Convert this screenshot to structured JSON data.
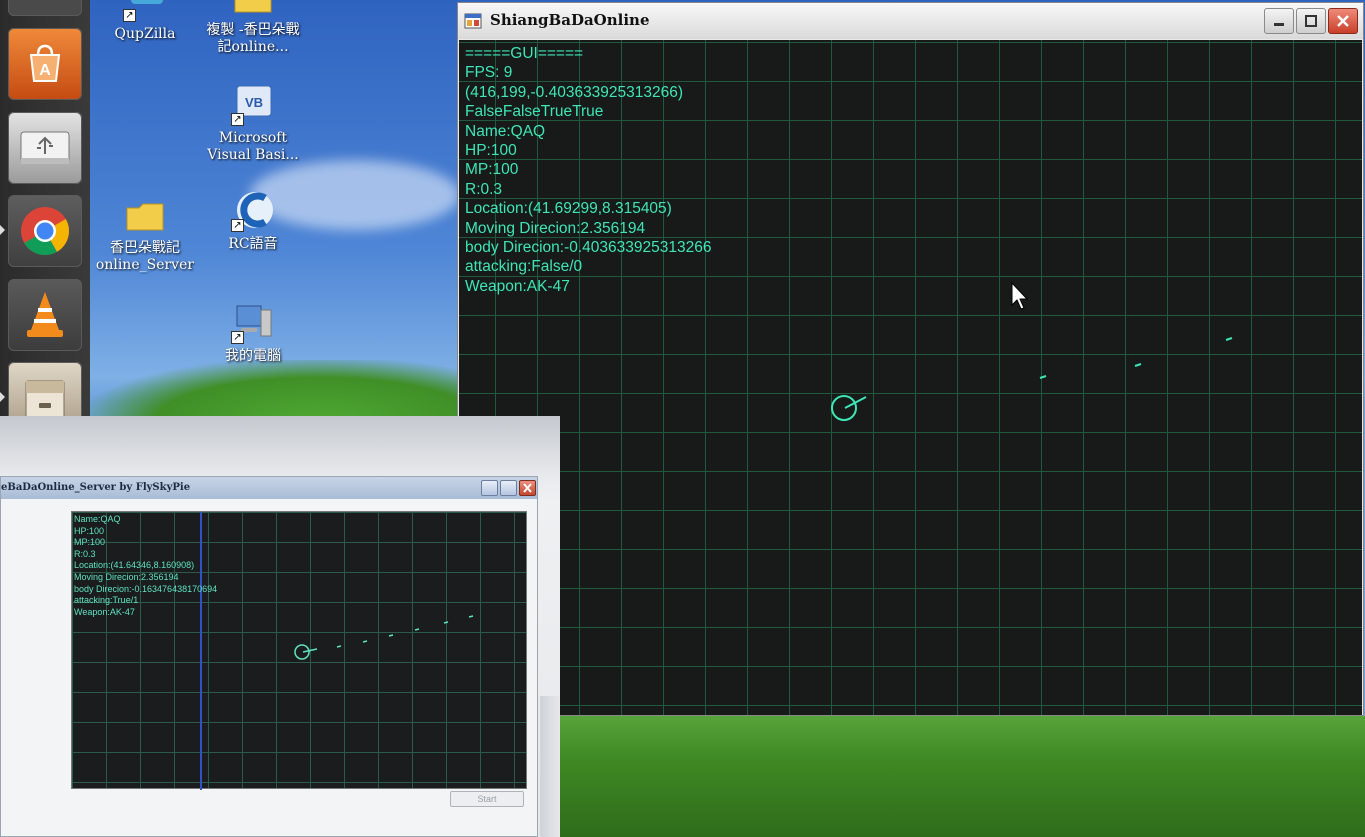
{
  "desktop": {
    "icons": [
      {
        "label": "QupZilla",
        "icon": "qupzilla-icon"
      },
      {
        "label": "複製 -香巴朵戰記online...",
        "icon": "folder-icon"
      },
      {
        "label": "Microsoft Visual Basi...",
        "icon": "visual-basic-icon"
      },
      {
        "label": "香巴朵戰記online_Server",
        "icon": "folder-icon"
      },
      {
        "label": "RC語音",
        "icon": "rc-voice-icon"
      },
      {
        "label": "我的電腦",
        "icon": "my-computer-icon"
      }
    ],
    "dock": [
      "software-center-icon",
      "usb-drive-icon",
      "chrome-icon",
      "vlc-icon",
      "files-icon"
    ]
  },
  "game_window": {
    "title": "ShiangBaDaOnline",
    "gui_lines": [
      "=====GUI=====",
      "FPS: 9",
      "(416,199,-0.403633925313266)",
      "FalseFalseTrueTrue",
      "Name:QAQ",
      "HP:100",
      "MP:100",
      "R:0.3",
      "Location:(41.69299,8.315405)",
      "Moving Direcion:2.356194",
      "body Direcion:-0.403633925313266",
      "attacking:False/0",
      "Weapon:AK-47"
    ],
    "colors": {
      "grid": "#1f5a3f",
      "text": "#3ee6b6",
      "background": "#171a19"
    }
  },
  "server_window": {
    "title": "eBaDaOnline_Server    by FlySkyPie",
    "lines": [
      "Name:QAQ",
      "HP:100",
      "MP:100",
      "R:0.3",
      "Location:(41.64346,8.160908)",
      "Moving Direcion:2.356194",
      "body Direcion:-0.163476438170694",
      "attacking:True/1",
      "Weapon:AK-47"
    ],
    "button_label": "Start"
  }
}
